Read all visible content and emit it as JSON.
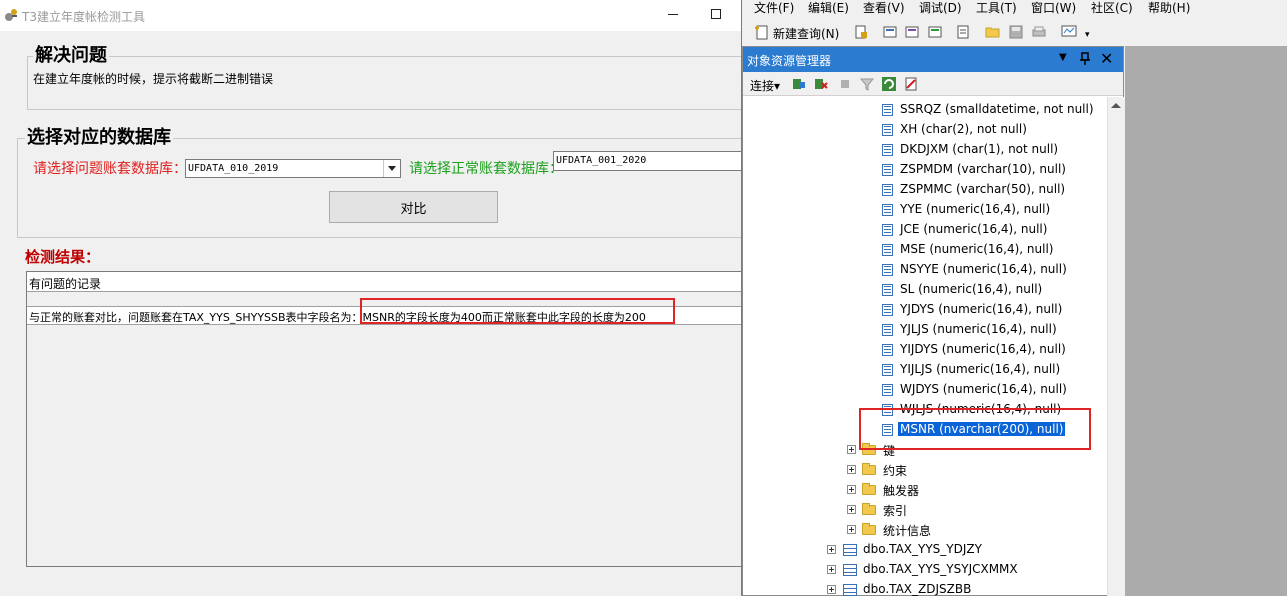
{
  "window": {
    "title": "T3建立年度帐检测工具"
  },
  "problem_section": {
    "title": "解决问题",
    "description": "在建立年度帐的时候，提示将截断二进制错误"
  },
  "db_section": {
    "title": "选择对应的数据库",
    "problem_db_label": "请选择问题账套数据库：",
    "problem_db_value": "UFDATA_010_2019",
    "normal_db_label": "请选择正常账套数据库：",
    "normal_db_value": "UFDATA_001_2020",
    "compare_button": "对比"
  },
  "results": {
    "label": "检测结果：",
    "header": "有问题的记录",
    "row_text": "与正常的账套对比，问题账套在TAX_YYS_SHYYSSB表中字段名为：MSNR的字段长度为400而正常账套中此字段的长度为200"
  },
  "ssms": {
    "menu": [
      "文件(F)",
      "编辑(E)",
      "查看(V)",
      "调试(D)",
      "工具(T)",
      "窗口(W)",
      "社区(C)",
      "帮助(H)"
    ],
    "toolbar": {
      "new_query": "新建查询(N)"
    },
    "object_explorer": {
      "title": "对象资源管理器",
      "pin": "ᵖ",
      "close": "✕",
      "connect": "连接▾",
      "columns": [
        "SSRQZ (smalldatetime, not null)",
        "XH (char(2), not null)",
        "DKDJXM (char(1), not null)",
        "ZSPMDM (varchar(10), null)",
        "ZSPMMC (varchar(50), null)",
        "YYE (numeric(16,4), null)",
        "JCE (numeric(16,4), null)",
        "MSE (numeric(16,4), null)",
        "NSYYE (numeric(16,4), null)",
        "SL (numeric(16,4), null)",
        "YJDYS (numeric(16,4), null)",
        "YJLJS (numeric(16,4), null)",
        "YIJDYS (numeric(16,4), null)",
        "YIJLJS (numeric(16,4), null)",
        "WJDYS (numeric(16,4), null)",
        "WJLJS (numeric(16,4), null)"
      ],
      "selected_column": "MSNR (nvarchar(200), null)",
      "folders": [
        "键",
        "约束",
        "触发器",
        "索引",
        "统计信息"
      ],
      "tables": [
        "dbo.TAX_YYS_YDJZY",
        "dbo.TAX_YYS_YSYJCXMMX",
        "dbo.TAX_ZDJSZBB"
      ]
    }
  },
  "colors": {
    "highlight_red": "#e02424",
    "label_red": "#e02020",
    "label_green": "#1aa01a",
    "oe_header_blue": "#2b7bd0",
    "selected_blue": "#0a64d8"
  }
}
